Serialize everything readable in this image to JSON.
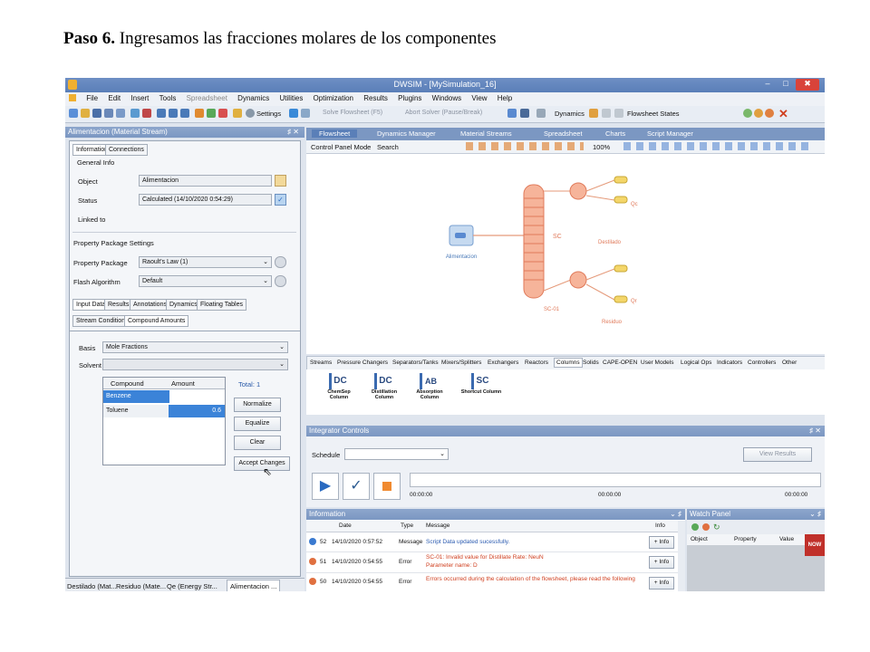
{
  "heading": {
    "step": "Paso 6.",
    "text": "Ingresamos las fracciones molares de los componentes"
  },
  "window": {
    "title": "DWSIM - [MySimulation_16]",
    "min": "–",
    "max": "□",
    "close": "✖"
  },
  "menu": [
    "File",
    "Edit",
    "Insert",
    "Tools",
    "Spreadsheet",
    "Dynamics",
    "Utilities",
    "Optimization",
    "Results",
    "Plugins",
    "Windows",
    "View",
    "Help"
  ],
  "toolbar": {
    "settings": "Settings",
    "solve": "Solve Flowsheet (F5)",
    "abort": "Abort Solver (Pause/Break)",
    "dynamics": "Dynamics",
    "flowsheet_states": "Flowsheet States"
  },
  "left_panel": {
    "title": "Alimentacion (Material Stream)",
    "tabs": [
      "Information",
      "Connections"
    ],
    "general_info": "General Info",
    "object_label": "Object",
    "object_value": "Alimentacion",
    "status_label": "Status",
    "status_value": "Calculated (14/10/2020 0:54:29)",
    "linked_label": "Linked to",
    "pp_settings": "Property Package Settings",
    "pp_label": "Property Package",
    "pp_value": "Raoult's Law (1)",
    "flash_label": "Flash Algorithm",
    "flash_value": "Default",
    "data_tabs": [
      "Input Data",
      "Results",
      "Annotations",
      "Dynamics",
      "Floating Tables"
    ],
    "sub_tabs": [
      "Stream Conditions",
      "Compound Amounts"
    ],
    "basis_label": "Basis",
    "basis_value": "Mole Fractions",
    "solvent_label": "Solvent",
    "table_headers": [
      "Compound",
      "Amount"
    ],
    "rows": [
      {
        "name": "Benzene",
        "amount": ""
      },
      {
        "name": "Toluene",
        "amount": "0.6"
      }
    ],
    "total": "Total: 1",
    "buttons": [
      "Normalize",
      "Equalize",
      "Clear",
      "Accept Changes"
    ],
    "bottom_tabs": [
      "Destilado (Mat...",
      "Residuo (Mate...",
      "Qe (Energy Str...",
      "Alimentacion ..."
    ]
  },
  "doc_tabs": [
    "Flowsheet",
    "Dynamics Manager",
    "Material Streams",
    "Spreadsheet",
    "Charts",
    "Script Manager"
  ],
  "flowsheet": {
    "control_mode": "Control Panel Mode",
    "search": "Search",
    "zoom": "100%",
    "labels": {
      "feed": "Alimentacion",
      "column_tag": "SC",
      "column_name": "SC-01",
      "qc": "Qc",
      "distillate": "Destilado",
      "qr": "Qr",
      "residue": "Residuo"
    }
  },
  "palette": {
    "tabs": [
      "Streams",
      "Pressure Changers",
      "Separators/Tanks",
      "Mixers/Splitters",
      "Exchangers",
      "Reactors",
      "Columns",
      "Solids",
      "CAPE-OPEN",
      "User Models",
      "Logical Ops",
      "Indicators",
      "Controllers",
      "Other"
    ],
    "items": [
      {
        "code": "DC",
        "name": "ChemSep Column"
      },
      {
        "code": "DC",
        "name": "Distillation Column"
      },
      {
        "code": "AB",
        "name": "Absorption Column"
      },
      {
        "code": "SC",
        "name": "Shortcut Column"
      }
    ]
  },
  "integrator": {
    "title": "Integrator Controls",
    "schedule": "Schedule",
    "view_results": "View Results",
    "times": [
      "00:00:00",
      "00:00:00",
      "00:00:00"
    ]
  },
  "info": {
    "title": "Information",
    "headers": [
      "Date",
      "Type",
      "Message",
      "Info"
    ],
    "rows": [
      {
        "num": "52",
        "date": "14/10/2020 0:57:52",
        "type": "Message",
        "msg": "Script Data updated sucessfully.",
        "msg2": "",
        "info": "+ Info"
      },
      {
        "num": "51",
        "date": "14/10/2020 0:54:55",
        "type": "Error",
        "msg": "SC-01: Invalid value for Distillate Rate: NeuN",
        "msg2": "Parameter name: D",
        "info": "+ Info"
      },
      {
        "num": "50",
        "date": "14/10/2020 0:54:55",
        "type": "Error",
        "msg": "Errors occurred during the calculation of the flowsheet, please read the following",
        "msg2": "",
        "info": "+ Info"
      }
    ]
  },
  "watch": {
    "title": "Watch Panel",
    "headers": [
      "Object",
      "Property",
      "Value"
    ],
    "badge": "NOW"
  },
  "colors": {
    "accent": "#5a7fb8",
    "orange": "#f08a5d",
    "selected": "#3b83d8"
  }
}
